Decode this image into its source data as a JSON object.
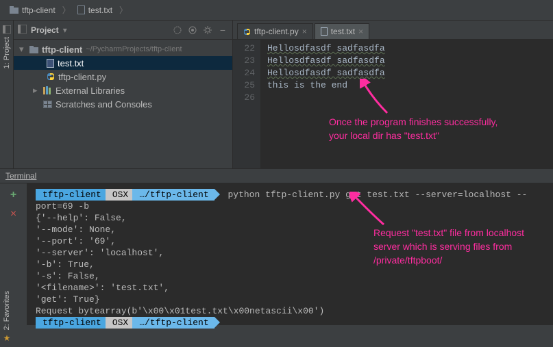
{
  "breadcrumb": {
    "item1": "tftp-client",
    "item2": "test.txt"
  },
  "project_panel": {
    "title": "Project",
    "root": "tftp-client",
    "root_path": "~/PycharmProjects/tftp-client",
    "file1": "test.txt",
    "file2": "tftp-client.py",
    "external": "External Libraries",
    "scratches": "Scratches and Consoles"
  },
  "sidebar": {
    "project_label": "1: Project",
    "favorites_label": "2: Favorites"
  },
  "tabs": {
    "tab1": "tftp-client.py",
    "tab2": "test.txt"
  },
  "editor": {
    "line_nums": [
      "22",
      "23",
      "24",
      "25",
      "26"
    ],
    "lines": [
      "Hellosdfasdf sadfasdfa",
      "Hellosdfasdf sadfasdfa",
      "Hellosdfasdf sadfasdfa",
      "this is the end",
      ""
    ]
  },
  "annotation1": "Once the program finishes successfully, your local dir has \"test.txt\"",
  "terminal": {
    "title": "Terminal",
    "prompt": {
      "seg1": "tftp-client",
      "seg2": "OSX",
      "seg3": "…/tftp-client"
    },
    "cmd": "python tftp-client.py get test.txt --server=localhost --port=69 -b",
    "out": [
      "{'--help': False,",
      " '--mode': None,",
      " '--port': '69',",
      " '--server': 'localhost',",
      " '-b': True,",
      " '-s': False,",
      " '<filename>': 'test.txt',",
      " 'get': True}",
      "Request bytearray(b'\\x00\\x01test.txt\\x00netascii\\x00')"
    ]
  },
  "annotation2": "Request \"test.txt\" file from localhost server which is serving files from /private/tftpboot/"
}
